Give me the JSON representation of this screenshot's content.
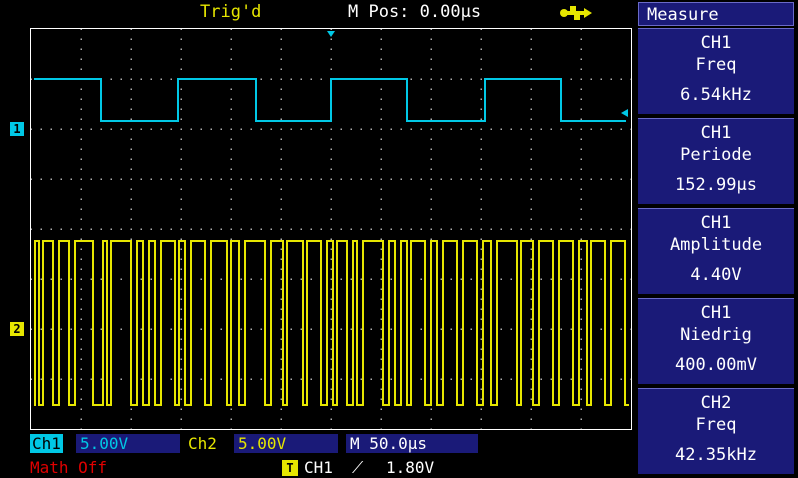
{
  "header": {
    "trigger_status": "Trig'd",
    "main_position": "M Pos: 0.00µs",
    "usb_icon": "usb-icon"
  },
  "colors": {
    "ch1": "#00c8e6",
    "ch2": "#e6e600",
    "panel": "#1a1a78",
    "math_off": "#e00000"
  },
  "channels": {
    "ch1_marker": "1",
    "ch2_marker": "2"
  },
  "measure": {
    "title": "Measure",
    "items": [
      {
        "source": "CH1",
        "name": "Freq",
        "value": "6.54kHz"
      },
      {
        "source": "CH1",
        "name": "Periode",
        "value": "152.99µs"
      },
      {
        "source": "CH1",
        "name": "Amplitude",
        "value": "4.40V"
      },
      {
        "source": "CH1",
        "name": "Niedrig",
        "value": "400.00mV"
      },
      {
        "source": "CH2",
        "name": "Freq",
        "value": "42.35kHz"
      }
    ]
  },
  "status": {
    "ch1_label": "Ch1",
    "ch1_scale": "5.00V",
    "ch2_label": "Ch2",
    "ch2_scale": "5.00V",
    "timebase": "M 50.0µs",
    "math": "Math Off",
    "trigger_icon": "T",
    "trigger_source": "CH1",
    "trigger_edge": "⟋",
    "trigger_level": "1.80V"
  }
}
